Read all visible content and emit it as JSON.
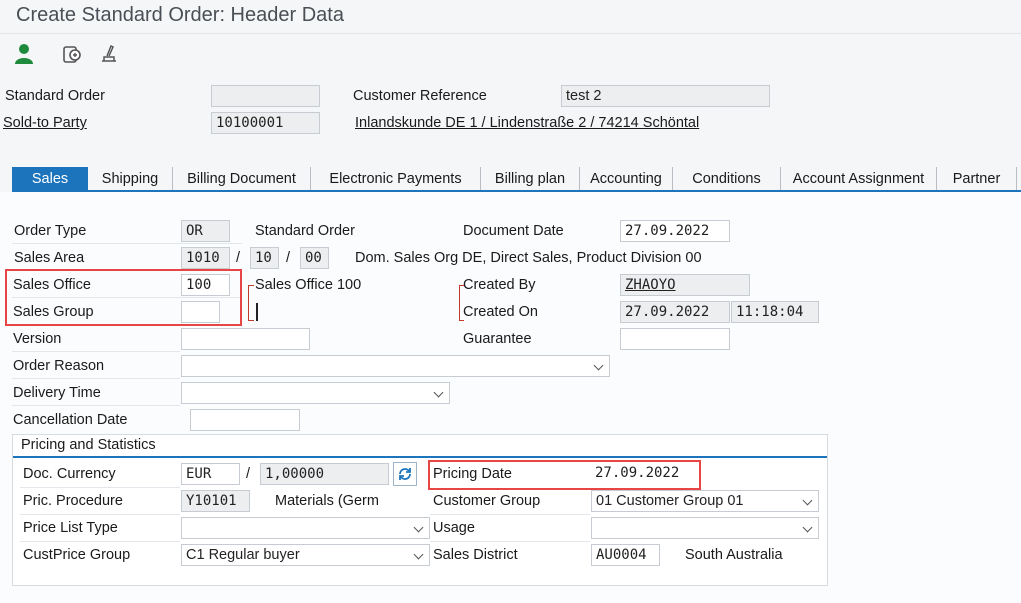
{
  "window": {
    "title": "Create Standard Order: Header Data"
  },
  "toolbar": {
    "icons": [
      "person-icon",
      "display-document-icon",
      "sign-icon"
    ]
  },
  "header": {
    "standard_order_label": "Standard Order",
    "standard_order_value": "",
    "customer_reference_label": "Customer Reference",
    "customer_reference_value": "test 2",
    "sold_to_label": "Sold-to Party",
    "sold_to_value": "10100001",
    "sold_to_description": "Inlandskunde DE 1 / Lindenstraße 2 / 74214 Schöntal"
  },
  "tabs": [
    "Sales",
    "Shipping",
    "Billing Document",
    "Electronic Payments",
    "Billing plan",
    "Accounting",
    "Conditions",
    "Account Assignment",
    "Partner"
  ],
  "sales": {
    "order_type_label": "Order Type",
    "order_type_value": "OR",
    "order_type_text": "Standard Order",
    "document_date_label": "Document Date",
    "document_date_value": "27.09.2022",
    "sales_area_label": "Sales Area",
    "sales_area_org": "1010",
    "sales_area_channel": "10",
    "sales_area_division": "00",
    "sales_area_sep": "/",
    "sales_area_text": "Dom. Sales Org DE, Direct Sales, Product Division 00",
    "sales_office_label": "Sales Office",
    "sales_office_value": "100",
    "sales_office_text": "Sales Office 100",
    "created_by_label": "Created By",
    "created_by_value": "ZHAOYO",
    "sales_group_label": "Sales Group",
    "sales_group_value": "",
    "created_on_label": "Created On",
    "created_on_date": "27.09.2022",
    "created_on_time": "11:18:04",
    "version_label": "Version",
    "version_value": "",
    "guarantee_label": "Guarantee",
    "guarantee_value": "",
    "order_reason_label": "Order Reason",
    "order_reason_value": "",
    "delivery_time_label": "Delivery Time",
    "delivery_time_value": "",
    "cancellation_date_label": "Cancellation Date",
    "cancellation_date_value": ""
  },
  "pricing": {
    "group_title": "Pricing and Statistics",
    "doc_currency_label": "Doc. Currency",
    "doc_currency_value": "EUR",
    "exchange_sep": "/",
    "exchange_rate_value": "1,00000",
    "pricing_date_label": "Pricing Date",
    "pricing_date_value": "27.09.2022",
    "pric_procedure_label": "Pric. Procedure",
    "pric_procedure_value": "Y10101",
    "pric_procedure_text": "Materials (Germ",
    "customer_group_label": "Customer Group",
    "customer_group_value": "01 Customer Group 01",
    "price_list_type_label": "Price List Type",
    "price_list_type_value": "",
    "usage_label": "Usage",
    "usage_value": "",
    "custprice_group_label": "CustPrice Group",
    "custprice_group_value": "C1 Regular buyer",
    "sales_district_label": "Sales District",
    "sales_district_value": "AU0004",
    "sales_district_text": "South Australia"
  },
  "colors": {
    "accent": "#1c75bc",
    "highlight": "#e84545",
    "title": "#4a4f55"
  }
}
